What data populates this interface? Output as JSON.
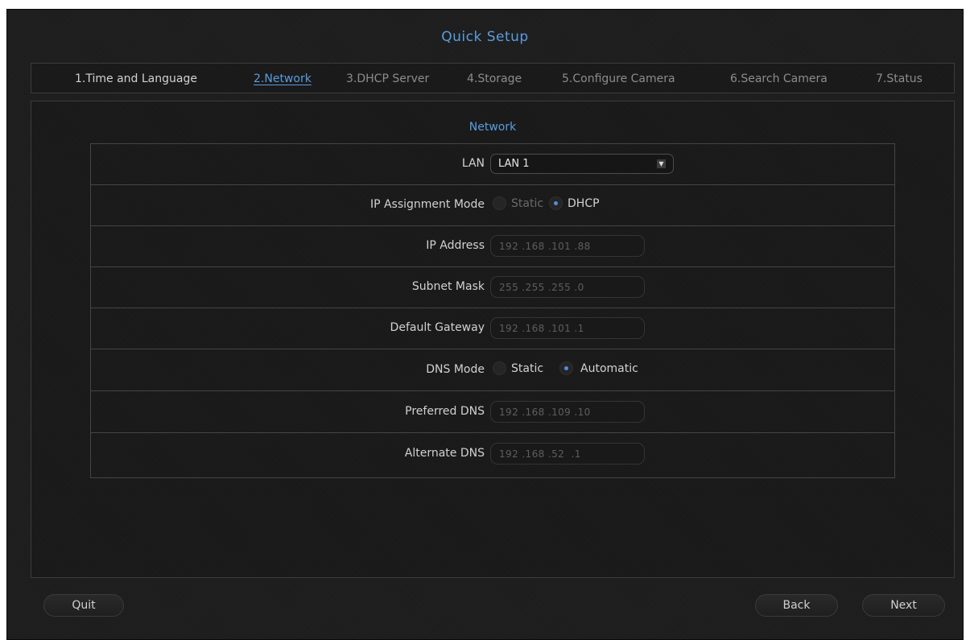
{
  "window": {
    "title": "Quick Setup"
  },
  "tabs": [
    {
      "label": "1.Time and Language"
    },
    {
      "label": "2.Network"
    },
    {
      "label": "3.DHCP Server"
    },
    {
      "label": "4.Storage"
    },
    {
      "label": "5.Configure Camera"
    },
    {
      "label": "6.Search Camera"
    },
    {
      "label": "7.Status"
    }
  ],
  "active_tab": "2.Network",
  "section": {
    "title": "Network"
  },
  "form": {
    "lan": {
      "label": "LAN",
      "value": "LAN 1",
      "arrow_icon": "dropdown-arrow-icon"
    },
    "ip_mode": {
      "label": "IP Assignment Mode",
      "options": [
        "Static",
        "DHCP"
      ],
      "selected": "DHCP"
    },
    "ip_address": {
      "label": "IP Address",
      "value": "192 .168 .101 .88"
    },
    "subnet_mask": {
      "label": "Subnet Mask",
      "value": "255 .255 .255 .0"
    },
    "gateway": {
      "label": "Default Gateway",
      "value": "192 .168 .101 .1"
    },
    "dns_mode": {
      "label": "DNS Mode",
      "options": [
        "Static",
        "Automatic"
      ],
      "selected": "Automatic"
    },
    "preferred_dns": {
      "label": "Preferred DNS",
      "value": "192 .168 .109 .10"
    },
    "alternate_dns": {
      "label": "Alternate DNS",
      "value": "192 .168 .52  .1"
    }
  },
  "buttons": {
    "quit": "Quit",
    "back": "Back",
    "next": "Next"
  },
  "colors": {
    "accent": "#5a9de0",
    "background": "#1e1e1e"
  }
}
